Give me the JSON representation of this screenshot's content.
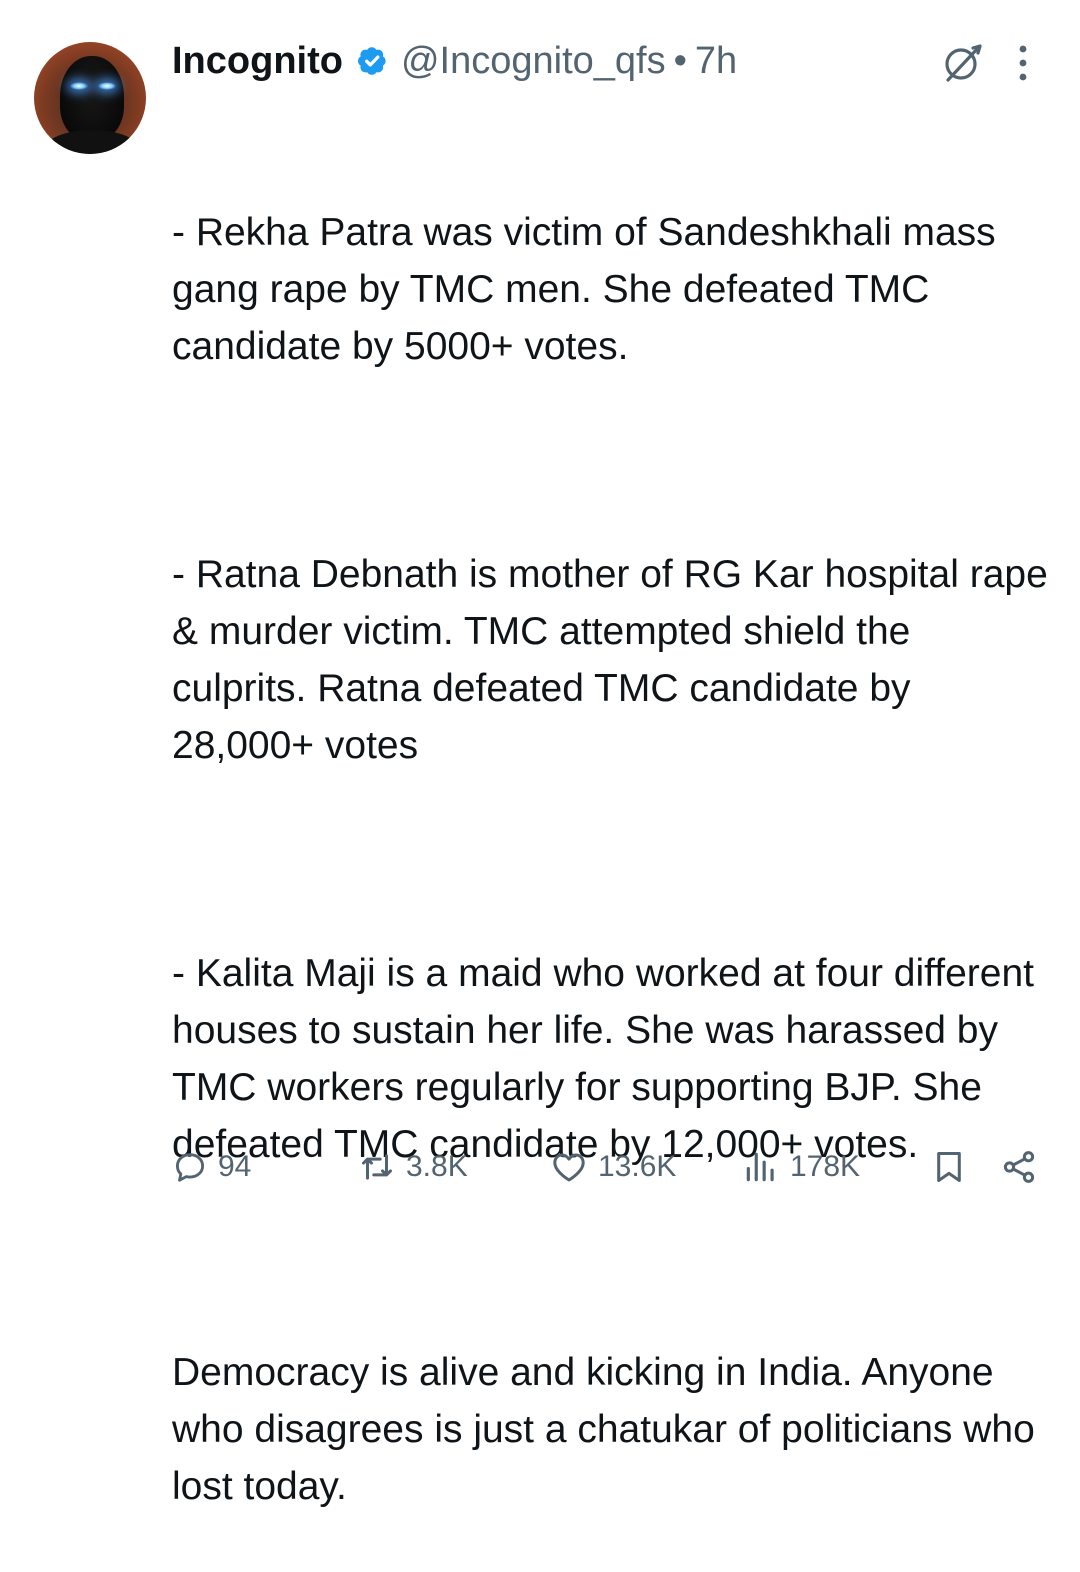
{
  "tweet": {
    "author_name": "Incognito",
    "handle": "@Incognito_qfs",
    "separator": "•",
    "time": "7h",
    "paragraphs": [
      "- Rekha Patra was victim of Sandeshkhali mass gang rape by TMC men. She defeated TMC candidate by 5000+ votes.",
      "- Ratna Debnath is mother of RG Kar hospital rape & murder victim. TMC attempted shield the culprits. Ratna defeated TMC candidate by 28,000+ votes",
      "- Kalita Maji is a maid who worked at four different houses to sustain her life. She was harassed by TMC workers regularly for supporting BJP. She defeated TMC candidate by 12,000+ votes.",
      "Democracy is alive and kicking in India. Anyone who disagrees is just a chatukar of politicians who lost today."
    ]
  },
  "actions": {
    "replies": "94",
    "reposts": "3.8K",
    "likes": "13.6K",
    "views": "178K"
  },
  "icons": {
    "verified": "verified-badge-icon",
    "grok": "grok-icon",
    "more": "more-vertical-icon",
    "reply": "reply-icon",
    "repost": "repost-icon",
    "like": "heart-icon",
    "views": "views-chart-icon",
    "bookmark": "bookmark-icon",
    "share": "share-icon"
  },
  "colors": {
    "text": "#0f1419",
    "secondary": "#536471",
    "verified_blue": "#1d9bf0"
  }
}
